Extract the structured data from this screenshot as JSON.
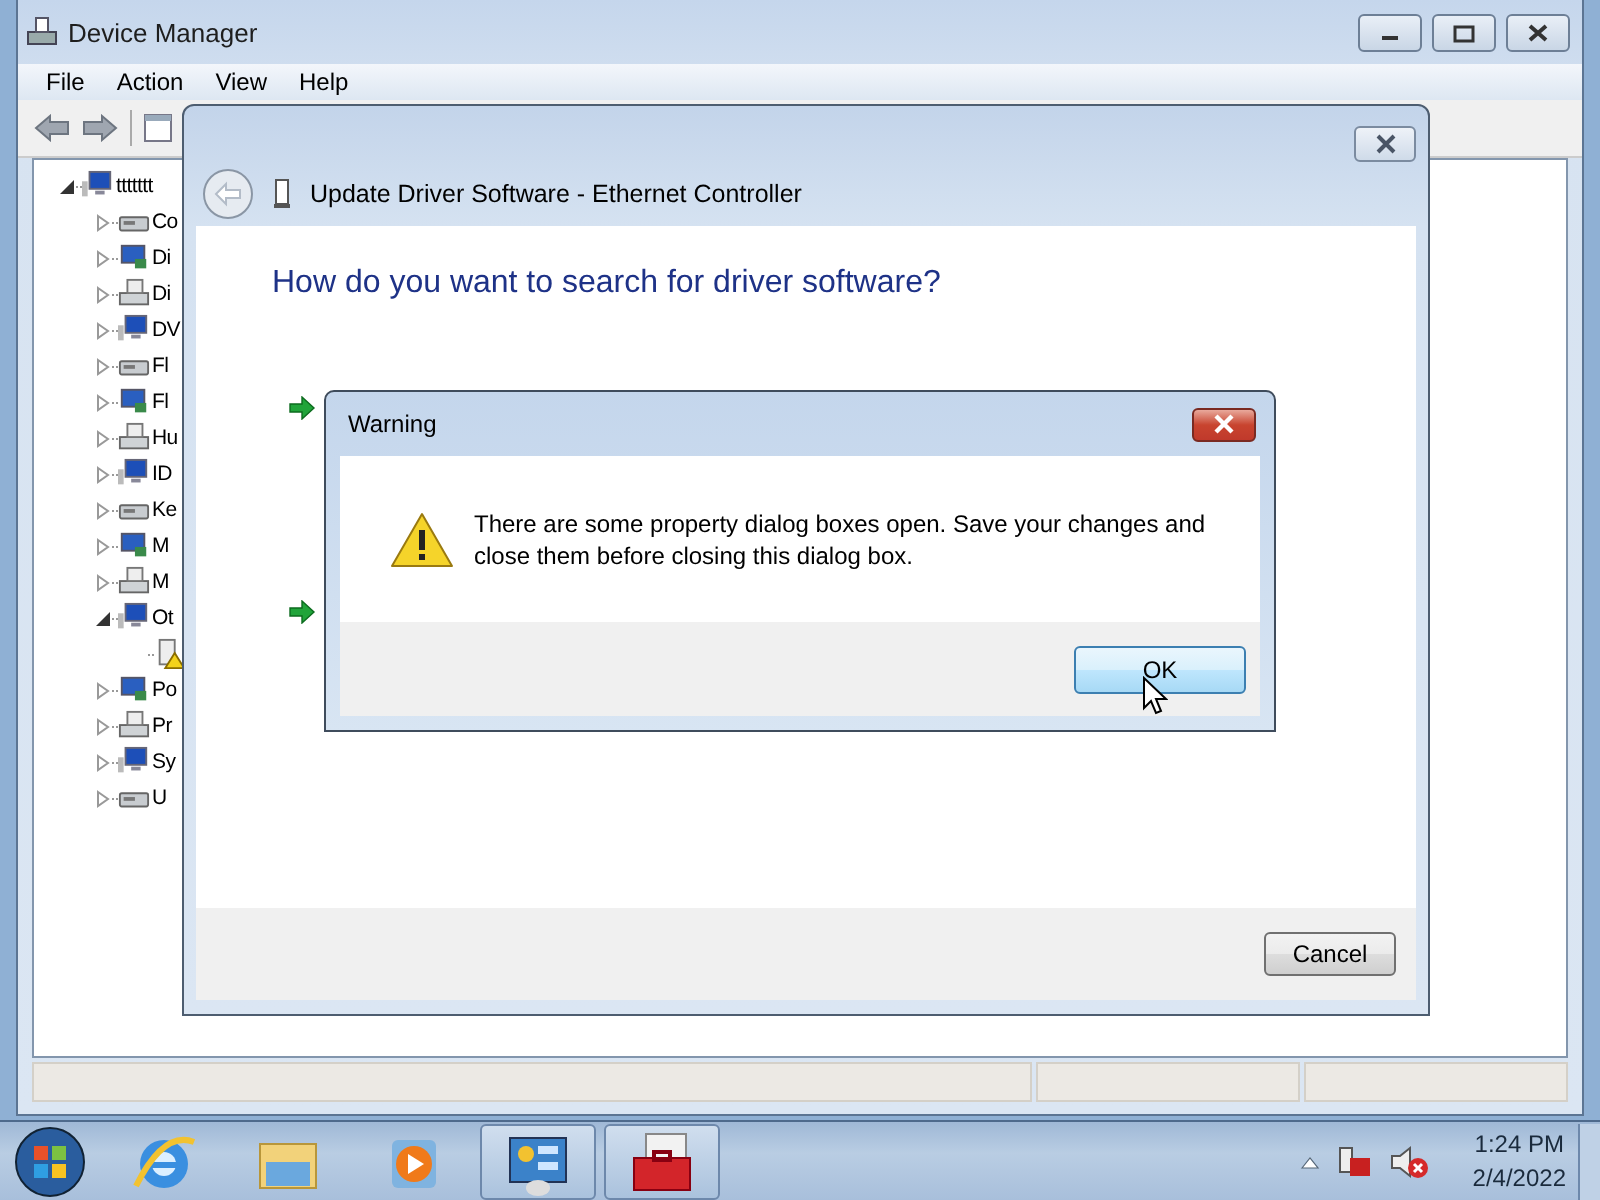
{
  "window": {
    "title": "Device Manager"
  },
  "menu": [
    "File",
    "Action",
    "View",
    "Help"
  ],
  "tree": [
    {
      "label": "ttttttt",
      "expanded": true,
      "children": [
        {
          "label": "Co",
          "expanded": false
        },
        {
          "label": "Di",
          "expanded": false
        },
        {
          "label": "Di",
          "expanded": false
        },
        {
          "label": "DV",
          "expanded": false
        },
        {
          "label": "Fl",
          "expanded": false
        },
        {
          "label": "Fl",
          "expanded": false
        },
        {
          "label": "Hu",
          "expanded": false
        },
        {
          "label": "ID",
          "expanded": false
        },
        {
          "label": "Ke",
          "expanded": false
        },
        {
          "label": "M",
          "expanded": false
        },
        {
          "label": "M",
          "expanded": false
        },
        {
          "label": "Ot",
          "expanded": true,
          "children": [
            {
              "warning": true
            }
          ]
        },
        {
          "label": "Po",
          "expanded": false
        },
        {
          "label": "Pr",
          "expanded": false
        },
        {
          "label": "Sy",
          "expanded": false
        },
        {
          "label": "U",
          "expanded": false
        }
      ]
    }
  ],
  "wizard": {
    "title": "Update Driver Software - Ethernet Controller",
    "heading": "How do you want to search for driver software?",
    "buttons": [
      "Cancel"
    ]
  },
  "warning": {
    "title": "Warning",
    "message": "There are some property dialog boxes open. Save your changes and close them before closing this dialog box.",
    "buttons": [
      {
        "label": "OK",
        "default": true
      }
    ]
  },
  "taskbar": {
    "pins": [
      {
        "running": false
      },
      {
        "running": false
      },
      {
        "running": false
      },
      {
        "running": true
      },
      {
        "running": true
      }
    ],
    "time": "1:24 PM",
    "date": "2/4/2022"
  }
}
